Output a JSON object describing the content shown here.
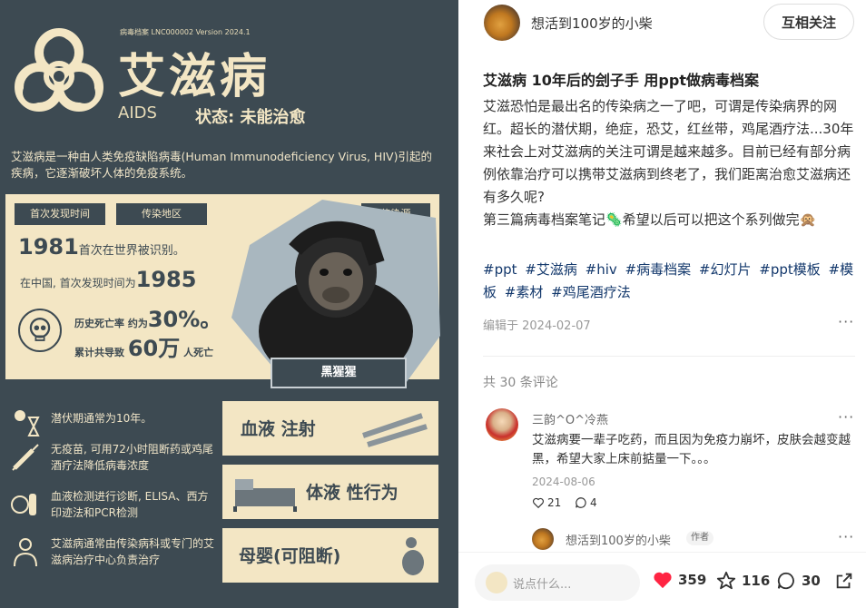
{
  "poster": {
    "meta": "病毒档案 LNC000002 Version 2024.1",
    "title": "艾滋病",
    "aids": "AIDS",
    "status": "状态: 未能治愈",
    "description": "艾滋病是一种由人类免疫缺陷病毒(Human Immunodeficiency Virus, HIV)引起的疾病，它逐渐破坏人体的免疫系统。",
    "tag_time": "首次发现时间",
    "tag_region": "传染地区",
    "tag_source": "传染源",
    "year": "1981",
    "year_text": "首次在世界被识别。",
    "china_prefix": "在中国, 首次发现时间为",
    "china_year": "1985",
    "death_prefix": "历史死亡率 约为",
    "death_rate": "30%。",
    "total_prefix": "累计共导致",
    "total_num": "60万",
    "total_suffix": "人死亡",
    "source_label": "黑猩猩",
    "fact1": "潜伏期通常为10年。",
    "fact2": "无疫苗, 可用72小时阻断药或鸡尾酒疗法降低病毒浓度",
    "fact3": "血液检测进行诊断, ELISA、西方印迹法和PCR检测",
    "fact4": "艾滋病通常由传染病科或专门的艾滋病治疗中心负责治疗",
    "route1": "血液 注射",
    "route2": "体液 性行为",
    "route3": "母婴(可阻断)"
  },
  "author": {
    "name": "想活到100岁的小柴",
    "follow_label": "互相关注"
  },
  "note": {
    "title": "艾滋病 10年后的刽子手 用ppt做病毒档案",
    "body": "艾滋恐怕是最出名的传染病之一了吧，可谓是传染病界的网红。超长的潜伏期，绝症，恐艾，红丝带，鸡尾酒疗法...30年来社会上对艾滋病的关注可谓是越来越多。目前已经有部分病例依靠治疗可以携带艾滋病到终老了，我们距离治愈艾滋病还有多久呢?\n第三篇病毒档案笔记🦠希望以后可以把这个系列做完🙊",
    "tags": [
      "#ppt",
      "#艾滋病",
      "#hiv",
      "#病毒档案",
      "#幻灯片",
      "#ppt模板",
      "#模板",
      "#素材",
      "#鸡尾酒疗法"
    ],
    "edit_date": "编辑于 2024-02-07",
    "more": "···"
  },
  "comments": {
    "count_label": "共 30 条评论",
    "items": [
      {
        "name": "三韵^O^冷燕",
        "text": "艾滋病要一辈子吃药，而且因为免疫力崩坏，皮肤会越变越黑，希望大家上床前掂量一下。。。",
        "date": "2024-08-06",
        "likes": "21",
        "replies": "4"
      }
    ],
    "reply": {
      "name": "想活到100岁的小柴",
      "badge": "作者"
    }
  },
  "bottom_bar": {
    "placeholder": "说点什么...",
    "likes": "359",
    "favorites": "116",
    "comments": "30"
  },
  "colors": {
    "poster_bg": "#3d4a52",
    "poster_cream": "#f3e6c4",
    "like_red": "#ff2442",
    "tag_blue": "#13386c"
  }
}
